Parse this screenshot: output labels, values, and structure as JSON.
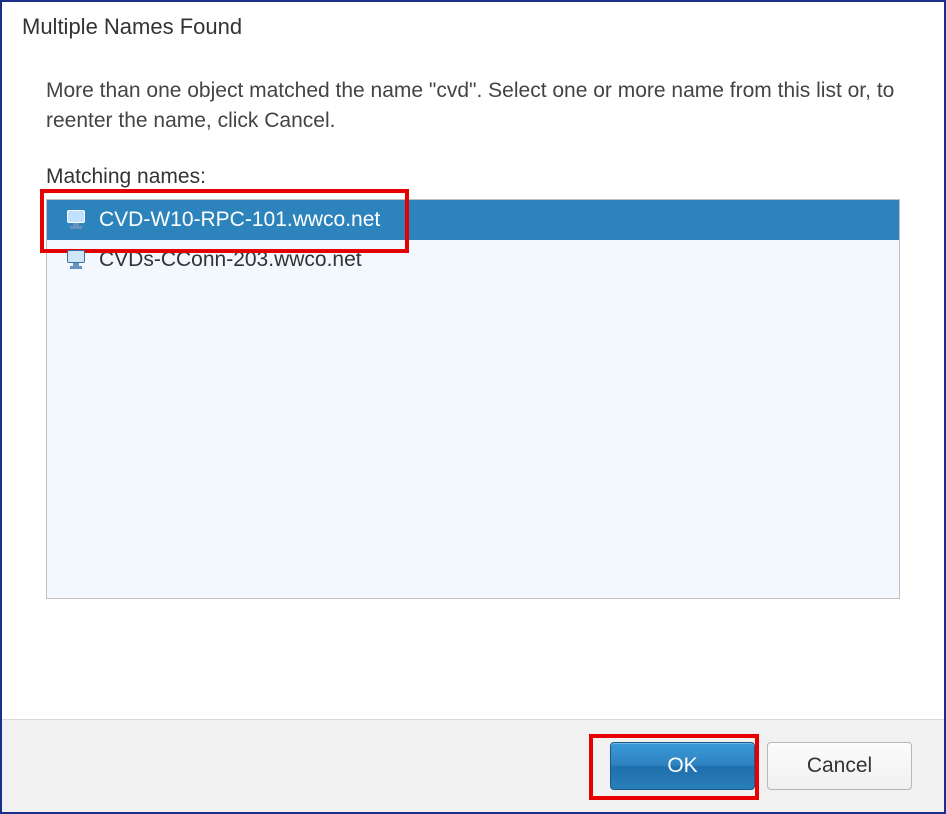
{
  "dialog": {
    "title": "Multiple Names Found",
    "prompt": "More than one object matched the name \"cvd\". Select one or more name from this list or, to reenter the name, click Cancel.",
    "matching_label": "Matching names:"
  },
  "list": {
    "items": [
      {
        "name": "CVD-W10-RPC-101.wwco.net",
        "selected": true
      },
      {
        "name": "CVDs-CConn-203.wwco.net",
        "selected": false
      }
    ]
  },
  "buttons": {
    "ok": "OK",
    "cancel": "Cancel"
  }
}
